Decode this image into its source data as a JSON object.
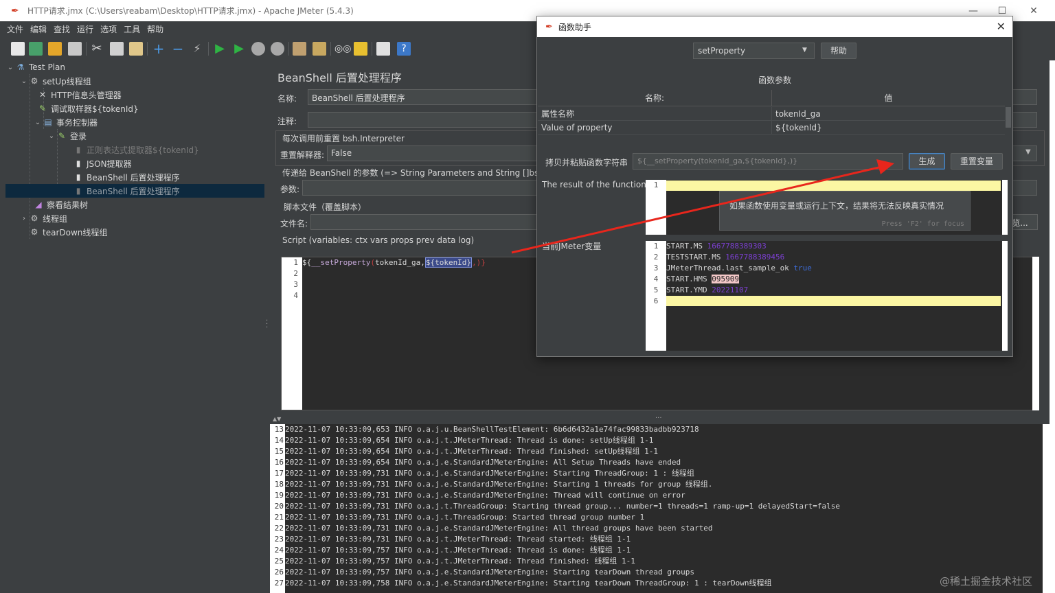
{
  "window": {
    "title": "HTTP请求.jmx (C:\\Users\\reabam\\Desktop\\HTTP请求.jmx) - Apache JMeter (5.4.3)"
  },
  "menu": [
    "文件",
    "编辑",
    "查找",
    "运行",
    "选项",
    "工具",
    "帮助"
  ],
  "tree": {
    "items": [
      {
        "label": "Test Plan",
        "icon": "flask-icon"
      },
      {
        "label": "setUp线程组",
        "icon": "gear-icon"
      },
      {
        "label": "HTTP信息头管理器",
        "icon": "tools-icon"
      },
      {
        "label": "调试取样器${tokenId}",
        "icon": "pencil-icon"
      },
      {
        "label": "事务控制器",
        "icon": "controller-icon"
      },
      {
        "label": "登录",
        "icon": "pencil-icon"
      },
      {
        "label": "正则表达式提取器${tokenId}",
        "icon": "document-icon"
      },
      {
        "label": "JSON提取器",
        "icon": "document-icon"
      },
      {
        "label": "BeanShell 后置处理程序",
        "icon": "document-icon"
      },
      {
        "label": "BeanShell 后置处理程序",
        "icon": "document-icon"
      },
      {
        "label": "察看结果树",
        "icon": "chart-icon"
      },
      {
        "label": "线程组",
        "icon": "gear-icon"
      },
      {
        "label": "tearDown线程组",
        "icon": "gear-icon"
      }
    ]
  },
  "panel": {
    "title": "BeanShell 后置处理程序",
    "name_label": "名称:",
    "name_value": "BeanShell 后置处理程序",
    "comment_label": "注释:",
    "reset_group": "每次调用前重置 bsh.Interpreter",
    "reset_label": "重置解释器:",
    "reset_value": "False",
    "params_group": "传递给 BeanShell 的参数 (=> String Parameters and String []bsh.args)",
    "params_label": "参数:",
    "file_group": "脚本文件（覆盖脚本）",
    "file_label": "文件名:",
    "browse_label": "览...",
    "script_group": "Script (variables: ctx vars props prev data log)",
    "script_lines": [
      "1",
      "2",
      "3",
      "4"
    ],
    "script_code": {
      "open": "${",
      "func": "__setProperty",
      "paren": "(",
      "arg1": "tokenId_ga,",
      "arg2": "${tokenId}",
      "close": ",)}"
    }
  },
  "log": [
    {
      "n": "13",
      "text": "2022-11-07 10:33:09,653 INFO o.a.j.u.BeanShellTestElement: 6b6d6432a1e74fac99833badbb923718"
    },
    {
      "n": "14",
      "text": "2022-11-07 10:33:09,654 INFO o.a.j.t.JMeterThread: Thread is done: setUp线程组 1-1"
    },
    {
      "n": "15",
      "text": "2022-11-07 10:33:09,654 INFO o.a.j.t.JMeterThread: Thread finished: setUp线程组 1-1"
    },
    {
      "n": "16",
      "text": "2022-11-07 10:33:09,654 INFO o.a.j.e.StandardJMeterEngine: All Setup Threads have ended"
    },
    {
      "n": "17",
      "text": "2022-11-07 10:33:09,731 INFO o.a.j.e.StandardJMeterEngine: Starting ThreadGroup: 1 : 线程组"
    },
    {
      "n": "18",
      "text": "2022-11-07 10:33:09,731 INFO o.a.j.e.StandardJMeterEngine: Starting 1 threads for group 线程组."
    },
    {
      "n": "19",
      "text": "2022-11-07 10:33:09,731 INFO o.a.j.e.StandardJMeterEngine: Thread will continue on error"
    },
    {
      "n": "20",
      "text": "2022-11-07 10:33:09,731 INFO o.a.j.t.ThreadGroup: Starting thread group... number=1 threads=1 ramp-up=1 delayedStart=false"
    },
    {
      "n": "21",
      "text": "2022-11-07 10:33:09,731 INFO o.a.j.t.ThreadGroup: Started thread group number 1"
    },
    {
      "n": "22",
      "text": "2022-11-07 10:33:09,731 INFO o.a.j.e.StandardJMeterEngine: All thread groups have been started"
    },
    {
      "n": "23",
      "text": "2022-11-07 10:33:09,731 INFO o.a.j.t.JMeterThread: Thread started: 线程组 1-1"
    },
    {
      "n": "24",
      "text": "2022-11-07 10:33:09,757 INFO o.a.j.t.JMeterThread: Thread is done: 线程组 1-1"
    },
    {
      "n": "25",
      "text": "2022-11-07 10:33:09,757 INFO o.a.j.t.JMeterThread: Thread finished: 线程组 1-1"
    },
    {
      "n": "26",
      "text": "2022-11-07 10:33:09,757 INFO o.a.j.e.StandardJMeterEngine: Starting tearDown thread groups"
    },
    {
      "n": "27",
      "text": "2022-11-07 10:33:09,758 INFO o.a.j.e.StandardJMeterEngine: Starting tearDown ThreadGroup: 1 : tearDown线程组"
    }
  ],
  "dialog": {
    "title": "函数助手",
    "function_select": "setProperty",
    "help_button": "帮助",
    "params_title": "函数参数",
    "col_name": "名称:",
    "col_value": "值",
    "rows": [
      {
        "name": "属性名称",
        "value": "tokenId_ga"
      },
      {
        "name": "Value of property",
        "value": "${tokenId}"
      }
    ],
    "copy_label": "拷贝并粘贴函数字符串",
    "function_string": "${__setProperty(tokenId_ga,${tokenId},)}",
    "generate_button": "生成",
    "reset_button": "重置变量",
    "result_label": "The result of the function is",
    "result_line": "1",
    "tooltip_text": "如果函数使用变量或运行上下文，结果将无法反映真实情况",
    "tooltip_foot": "Press 'F2' for focus",
    "vars_label": "当前JMeter变量",
    "vars": [
      {
        "n": "1",
        "key": "START.MS",
        "val": "1667788389303"
      },
      {
        "n": "2",
        "key": "TESTSTART.MS",
        "val": "1667788389456"
      },
      {
        "n": "3",
        "key": "JMeterThread.last_sample_ok",
        "val": "true"
      },
      {
        "n": "4",
        "key": "START.HMS",
        "val": "095909"
      },
      {
        "n": "5",
        "key": "START.YMD",
        "val": "20221107"
      },
      {
        "n": "6",
        "key": "",
        "val": ""
      }
    ]
  },
  "watermark": "@稀土掘金技术社区",
  "colors": {
    "bg": "#3c3f41",
    "editor_bg": "#2b2b2b",
    "selection": "#0d293e",
    "arrow": "#e8261c",
    "highlight_line": "#fbf6a3"
  }
}
